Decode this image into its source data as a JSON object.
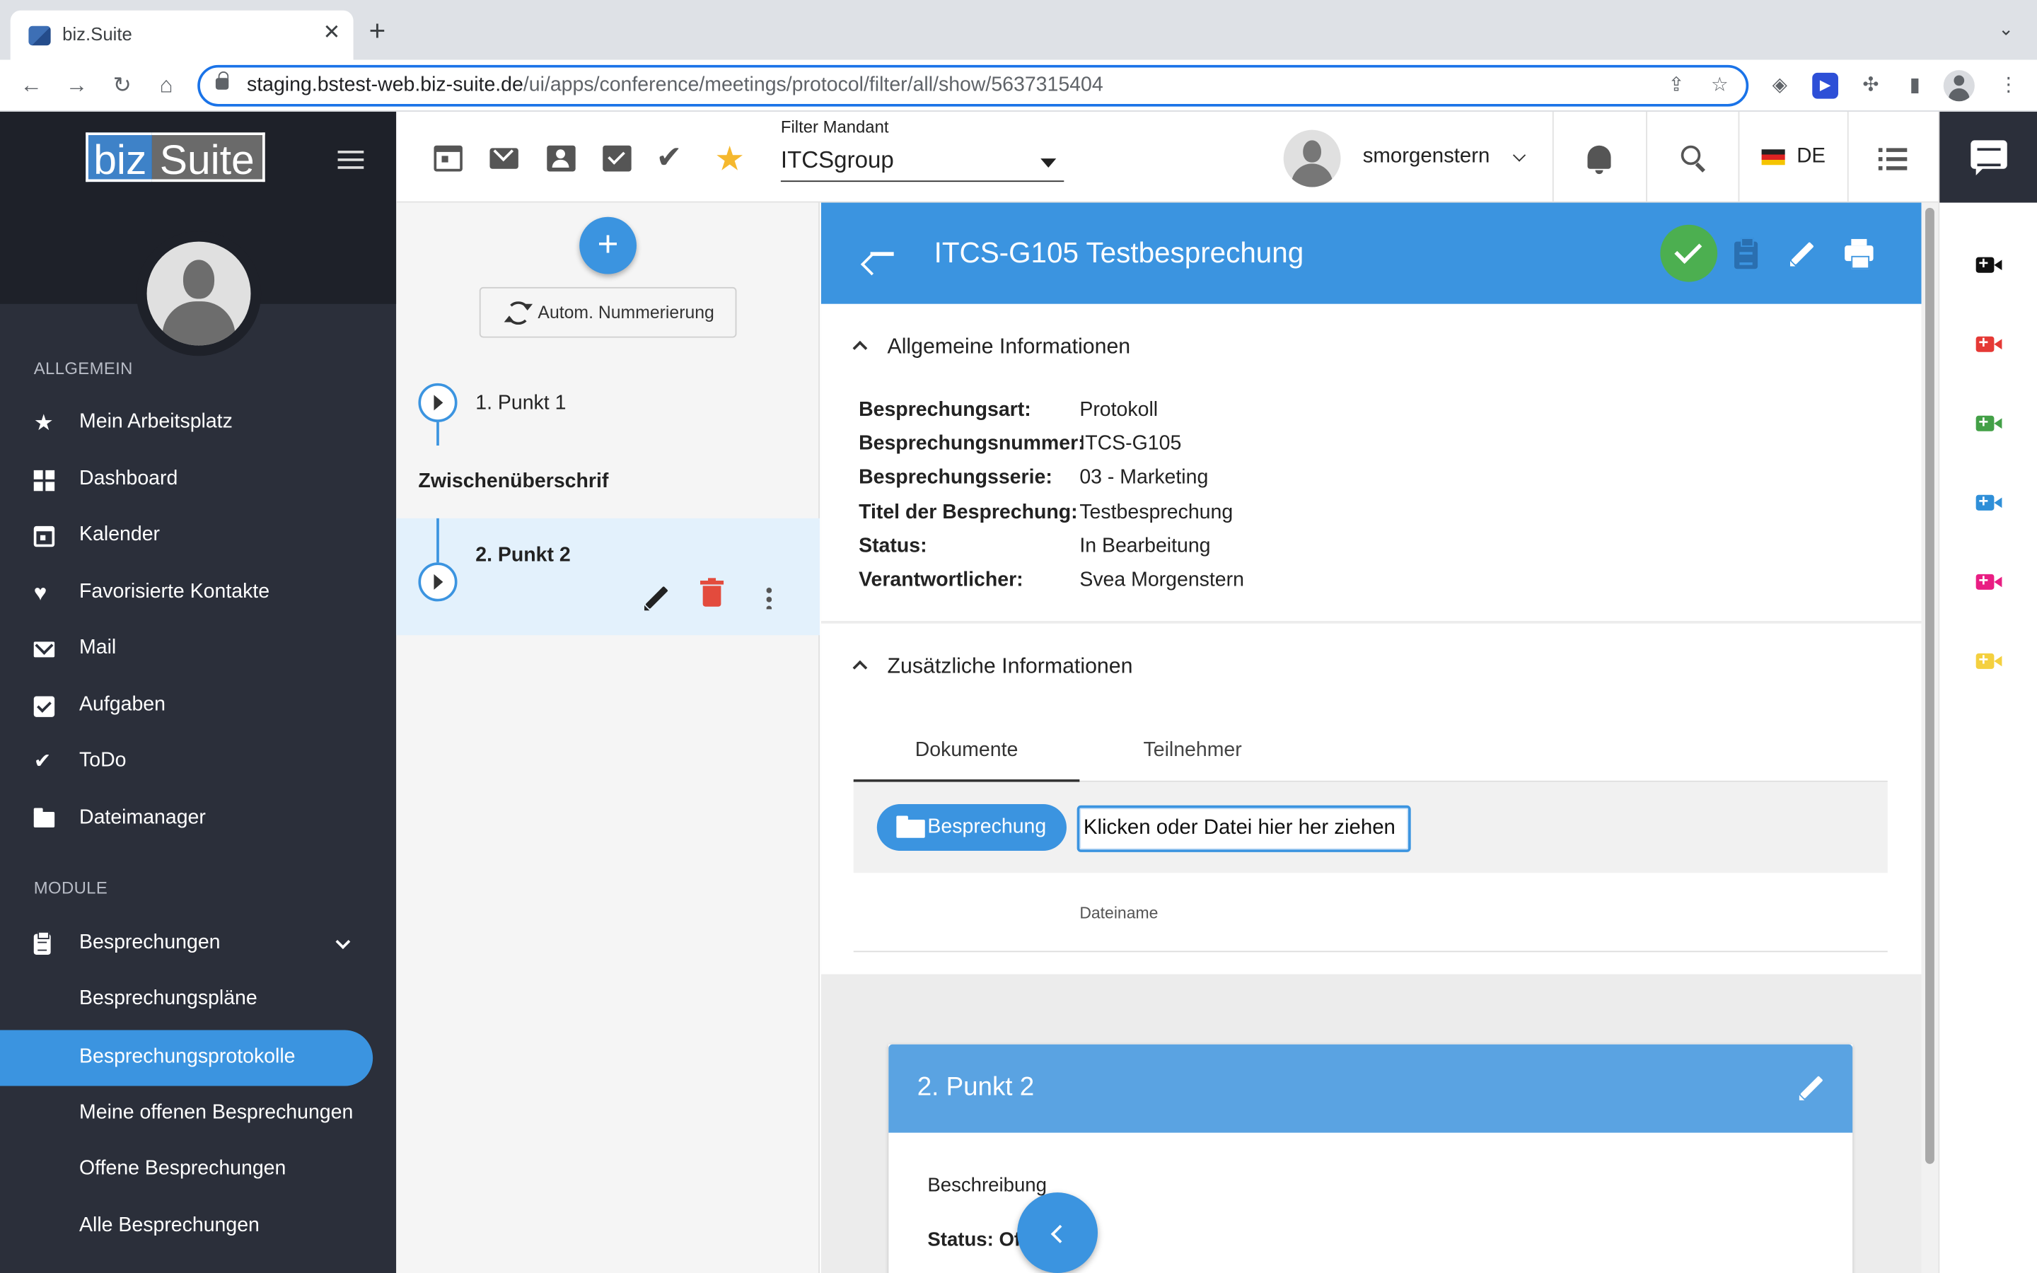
{
  "browser": {
    "tab_title": "biz.Suite",
    "url_host": "staging.bstest-web.biz-suite.de",
    "url_path": "/ui/apps/conference/meetings/protocol/filter/all/show/5637315404"
  },
  "brand": {
    "logo_left": "biz",
    "logo_right": "Suite"
  },
  "sidebar": {
    "section_general": "ALLGEMEIN",
    "general_items": [
      {
        "label": "Mein Arbeitsplatz",
        "icon": "star-icon"
      },
      {
        "label": "Dashboard",
        "icon": "dashboard-icon"
      },
      {
        "label": "Kalender",
        "icon": "calendar-icon"
      },
      {
        "label": "Favorisierte Kontakte",
        "icon": "heart-icon"
      },
      {
        "label": "Mail",
        "icon": "mail-icon"
      },
      {
        "label": "Aufgaben",
        "icon": "checkbox-icon"
      },
      {
        "label": "ToDo",
        "icon": "done-all-icon"
      },
      {
        "label": "Dateimanager",
        "icon": "folder-icon"
      }
    ],
    "section_modules": "MODULE",
    "module_items": [
      {
        "label": "Besprechungen",
        "icon": "clipboard-icon"
      },
      {
        "label": "Besprechungspläne"
      },
      {
        "label": "Besprechungsprotokolle",
        "active": true
      },
      {
        "label": "Meine offenen Besprechungen"
      },
      {
        "label": "Offene Besprechungen"
      },
      {
        "label": "Alle Besprechungen"
      }
    ]
  },
  "appbar": {
    "filter_label": "Filter Mandant",
    "filter_value": "ITCSgroup",
    "username": "smorgenstern",
    "language": "DE",
    "colors": {
      "star": "#f5b82e"
    }
  },
  "agenda": {
    "auto_numbering": "Autom. Nummerierung",
    "items": [
      {
        "label": "1. Punkt 1"
      },
      {
        "label": "Zwischenüberschrif"
      },
      {
        "label": "2. Punkt 2"
      }
    ]
  },
  "detail": {
    "title": "ITCS-G105 Testbesprechung",
    "section_general": "Allgemeine Informationen",
    "fields": [
      {
        "label": "Besprechungsart:",
        "value": "Protokoll"
      },
      {
        "label": "Besprechungsnummer:",
        "value": "ITCS-G105"
      },
      {
        "label": "Besprechungsserie:",
        "value": "03 - Marketing"
      },
      {
        "label": "Titel der Besprechung:",
        "value": "Testbesprechung"
      },
      {
        "label": "Status:",
        "value": "In Bearbeitung"
      },
      {
        "label": "Verantwortlicher:",
        "value": "Svea Morgenstern"
      }
    ],
    "section_additional": "Zusätzliche Informationen",
    "tabs": [
      "Dokumente",
      "Teilnehmer"
    ],
    "folder_button": "Besprechung",
    "dropzone": "Klicken oder Datei hier her ziehen",
    "file_column": "Dateiname",
    "colors": {
      "header": "#3b94e0",
      "done": "#4caf50"
    }
  },
  "point": {
    "title": "2. Punkt 2",
    "description": "Beschreibung",
    "status": "Status: Of"
  },
  "right_panel": {
    "video_colors": [
      "#111111",
      "#e53935",
      "#43a047",
      "#2f8fd8",
      "#e91e83",
      "#f4d03f"
    ]
  }
}
